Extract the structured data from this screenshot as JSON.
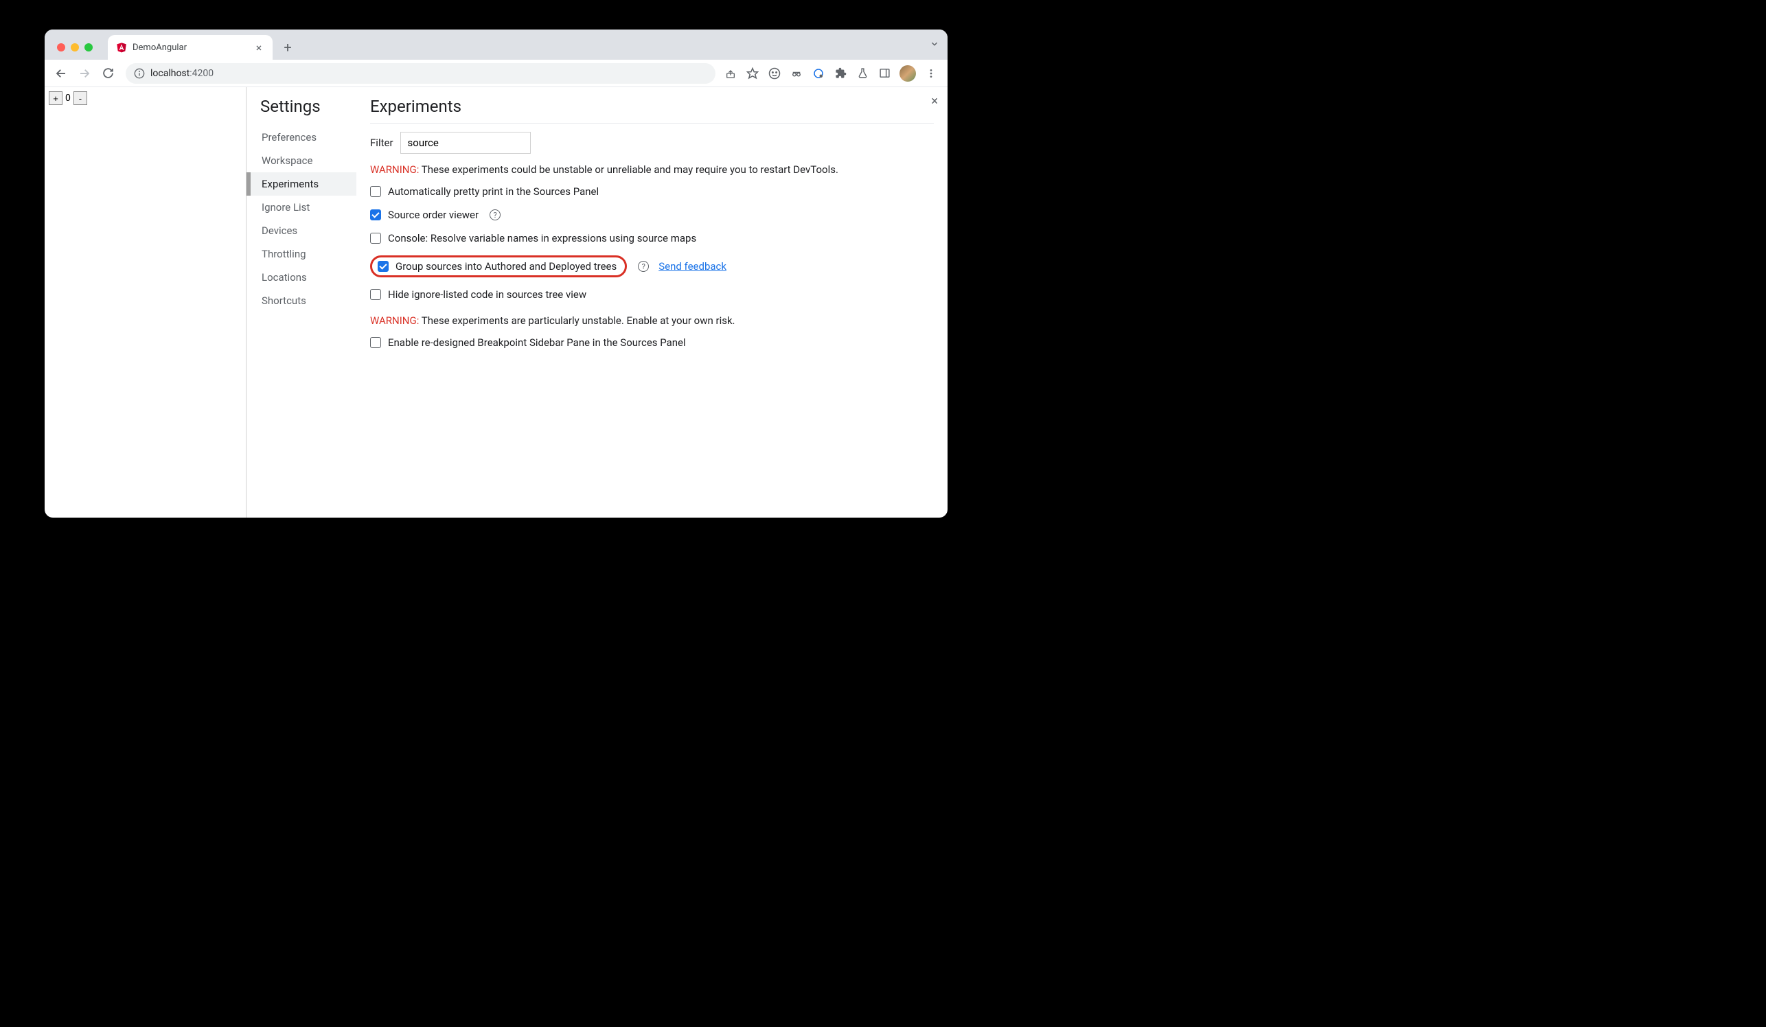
{
  "tab": {
    "title": "DemoAngular"
  },
  "url": {
    "host": "localhost",
    "port": ":4200"
  },
  "page": {
    "counter": "0"
  },
  "settings": {
    "title": "Settings",
    "nav": {
      "preferences": "Preferences",
      "workspace": "Workspace",
      "experiments": "Experiments",
      "ignore_list": "Ignore List",
      "devices": "Devices",
      "throttling": "Throttling",
      "locations": "Locations",
      "shortcuts": "Shortcuts"
    }
  },
  "main": {
    "title": "Experiments",
    "filter_label": "Filter",
    "filter_value": "source",
    "warning1_label": "WARNING:",
    "warning1_text": " These experiments could be unstable or unreliable and may require you to restart DevTools.",
    "warning2_label": "WARNING:",
    "warning2_text": " These experiments are particularly unstable. Enable at your own risk.",
    "feedback": "Send feedback",
    "items": {
      "pretty_print": "Automatically pretty print in the Sources Panel",
      "source_order": "Source order viewer",
      "resolve_vars": "Console: Resolve variable names in expressions using source maps",
      "group_sources": "Group sources into Authored and Deployed trees",
      "hide_ignored": "Hide ignore-listed code in sources tree view",
      "breakpoint_sidebar": "Enable re-designed Breakpoint Sidebar Pane in the Sources Panel"
    }
  },
  "glyphs": {
    "plus": "+",
    "minus": "-",
    "times": "×",
    "q": "?"
  }
}
